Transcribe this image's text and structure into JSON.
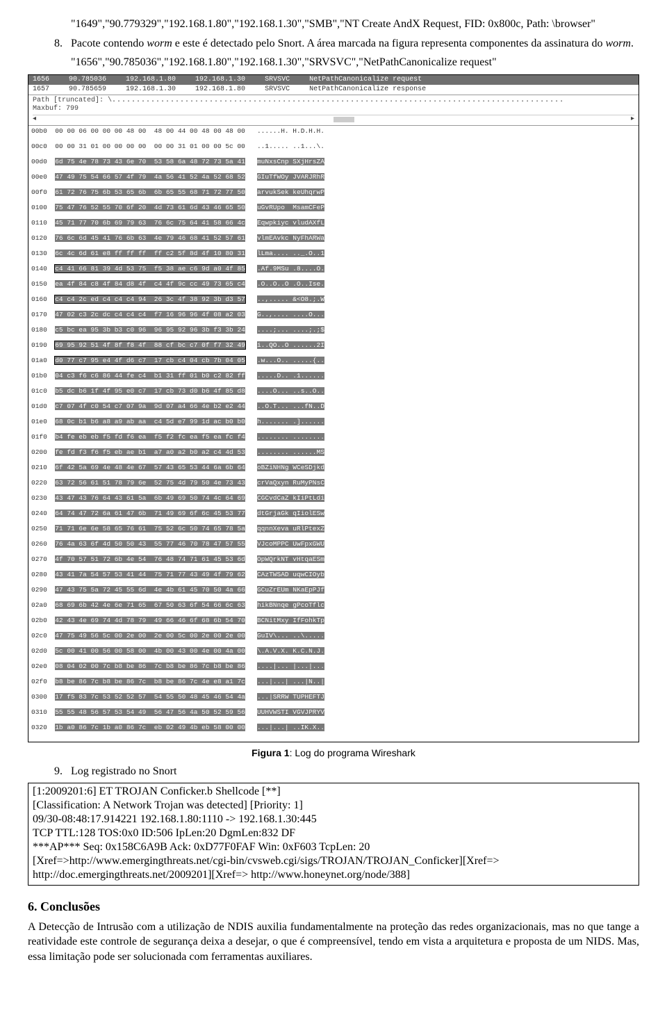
{
  "top": {
    "code_line": "\"1649\",\"90.779329\",\"192.168.1.80\",\"192.168.1.30\",\"SMB\",\"NT Create AndX Request, FID: 0x800c, Path: \\browser\"",
    "step8_num": "8.",
    "step8_text": "Pacote contendo worm e este é detectado pelo Snort. A área marcada na figura  representa componentes da assinatura do worm.",
    "code_line2": "\"1656\",\"90.785036\",\"192.168.1.80\",\"192.168.1.30\",\"SRVSVC\",\"NetPathCanonicalize request\""
  },
  "shot": {
    "list": {
      "row_sel": [
        "1656",
        "90.785036",
        "192.168.1.80",
        "192.168.1.30",
        "SRVSVC",
        "NetPathCanonicalize request"
      ],
      "row2": [
        "1657",
        "90.785659",
        "192.168.1.30",
        "192.168.1.80",
        "SRVSVC",
        "NetPathCanonicalize response"
      ]
    },
    "mid": {
      "path_label": "Path [truncated]: \\",
      "maxbuf": "Maxbuf: 799"
    }
  },
  "hex": [
    {
      "off": "00b0",
      "bytes": "00 00 06 00 00 00 48 00  48 00 44 00 48 00 48 00",
      "ascii": "......H. H.D.H.H."
    },
    {
      "off": "00c0",
      "bytes": "00 00 31 01 00 00 00 00  00 00 31 01 00 00 5c 00",
      "ascii": "..1..... ..1...\\."
    },
    {
      "off": "00d0",
      "bytes": "6d 75 4e 78 73 43 6e 70  53 58 6a 48 72 73 5a 41",
      "ascii": "muNxsCnp SXjHrsZA",
      "sel": true
    },
    {
      "off": "00e0",
      "bytes": "47 49 75 54 66 57 4f 79  4a 56 41 52 4a 52 68 52",
      "ascii": "GIuTfWOy JVARJRhR",
      "sel": true
    },
    {
      "off": "00f0",
      "bytes": "61 72 76 75 6b 53 65 6b  6b 65 55 68 71 72 77 50",
      "ascii": "arvukSek keUhqrwP",
      "sel": true
    },
    {
      "off": "0100",
      "bytes": "75 47 76 52 55 70 6f 20  4d 73 61 6d 43 46 65 50",
      "ascii": "uGvRUpo  MsamCFeP",
      "sel": true
    },
    {
      "off": "0110",
      "bytes": "45 71 77 70 6b 69 79 63  76 6c 75 64 41 58 66 4c",
      "ascii": "Eqwpkiyc vludAXfL",
      "sel": true
    },
    {
      "off": "0120",
      "bytes": "76 6c 6d 45 41 76 6b 63  4e 79 46 68 41 52 57 61",
      "ascii": "vlmEAvkc NyFhARWa",
      "sel": true
    },
    {
      "off": "0130",
      "bytes": "6c 4c 6d 61 e8 ff ff ff  ff c2 5f 8d 4f 10 80 31",
      "ascii": "lLma.... .._.O..1",
      "sel": true
    },
    {
      "off": "0140",
      "bytes": "c4 41 66 81 39 4d 53 75  f5 38 ae c6 9d a0 4f 85",
      "ascii": ".Af.9MSu .8....O.",
      "sel": true,
      "box": true
    },
    {
      "off": "0150",
      "bytes": "ea 4f 84 c8 4f 84 d8 4f  c4 4f 9c cc 49 73 65 c4",
      "ascii": ".O..O..O .O..Ise.",
      "sel": true
    },
    {
      "off": "0160",
      "bytes": "c4 c4 2c ed c4 c4 c4 94  26 3c 4f 38 92 3b d3 57",
      "ascii": "..,..... &<O8.;.W",
      "sel": true,
      "box": true
    },
    {
      "off": "0170",
      "bytes": "47 02 c3 2c dc c4 c4 c4  f7 16 96 96 4f 08 a2 03",
      "ascii": "G..,.... ....O...",
      "sel": true
    },
    {
      "off": "0180",
      "bytes": "c5 bc ea 95 3b b3 c0 96  96 95 92 96 3b f3 3b 24",
      "ascii": "....;... ....;.;$",
      "sel": true
    },
    {
      "off": "0190",
      "bytes": "69 95 92 51 4f 8f f8 4f  88 cf bc c7 0f f7 32 49",
      "ascii": "i..QO..O ......2I",
      "sel": true,
      "box": true
    },
    {
      "off": "01a0",
      "bytes": "d0 77 c7 95 e4 4f d6 c7  17 cb c4 04 cb 7b 04 05",
      "ascii": ".w...O.. .....{..",
      "sel": true,
      "box": true
    },
    {
      "off": "01b0",
      "bytes": "04 c3 f6 c6 86 44 fe c4  b1 31 ff 01 b0 c2 82 ff",
      "ascii": ".....D.. .1......",
      "sel": true
    },
    {
      "off": "01c0",
      "bytes": "b5 dc b6 1f 4f 95 e0 c7  17 cb 73 d0 b6 4f 85 d8",
      "ascii": "....O... ..s..O..",
      "sel": true
    },
    {
      "off": "01d0",
      "bytes": "c7 07 4f c0 54 c7 07 9a  9d 07 a4 66 4e b2 e2 44",
      "ascii": "..O.T... ...fN..D",
      "sel": true
    },
    {
      "off": "01e0",
      "bytes": "68 0c b1 b6 a8 a9 ab aa  c4 5d e7 99 1d ac b0 b0",
      "ascii": "h....... .]......",
      "sel": true
    },
    {
      "off": "01f0",
      "bytes": "b4 fe eb eb f5 fd f6 ea  f5 f2 fc ea f5 ea fc f4",
      "ascii": "........ ........",
      "sel": true
    },
    {
      "off": "0200",
      "bytes": "fe fd f3 f6 f5 eb ae b1  a7 a0 a2 b0 a2 c4 4d 53",
      "ascii": "........ ......MS",
      "sel": true
    },
    {
      "off": "0210",
      "bytes": "6f 42 5a 69 4e 48 4e 67  57 43 65 53 44 6a 6b 64",
      "ascii": "oBZiNHNg WCeSDjkd",
      "sel": true
    },
    {
      "off": "0220",
      "bytes": "63 72 56 61 51 78 79 6e  52 75 4d 79 50 4e 73 43",
      "ascii": "crVaQxyn RuMyPNsC",
      "sel": true
    },
    {
      "off": "0230",
      "bytes": "43 47 43 76 64 43 61 5a  6b 49 69 50 74 4c 64 69",
      "ascii": "CGCvdCaZ kIiPtLdi",
      "sel": true
    },
    {
      "off": "0240",
      "bytes": "64 74 47 72 6a 61 47 6b  71 49 69 6f 6c 45 53 77",
      "ascii": "dtGrjaGk qIiolESw",
      "sel": true
    },
    {
      "off": "0250",
      "bytes": "71 71 6e 6e 58 65 76 61  75 52 6c 50 74 65 78 5a",
      "ascii": "qqnnXeva uRlPtexZ",
      "sel": true
    },
    {
      "off": "0260",
      "bytes": "76 4a 63 6f 4d 50 50 43  55 77 46 70 78 47 57 55",
      "ascii": "VJcoMPPC UwFpxGWU",
      "sel": true
    },
    {
      "off": "0270",
      "bytes": "4f 70 57 51 72 6b 4e 54  76 48 74 71 61 45 53 6d",
      "ascii": "OpWQrkNT vHtqaESm",
      "sel": true
    },
    {
      "off": "0280",
      "bytes": "43 41 7a 54 57 53 41 44  75 71 77 43 49 4f 79 62",
      "ascii": "CAzTWSAD uqwCIOyb",
      "sel": true
    },
    {
      "off": "0290",
      "bytes": "47 43 75 5a 72 45 55 6d  4e 4b 61 45 70 50 4a 66",
      "ascii": "GCuZrEUm NKaEpPJf",
      "sel": true
    },
    {
      "off": "02a0",
      "bytes": "68 69 6b 42 4e 6e 71 65  67 50 63 6f 54 66 6c 63",
      "ascii": "hikBNnqe gPcoTflc",
      "sel": true
    },
    {
      "off": "02b0",
      "bytes": "42 43 4e 69 74 4d 78 79  49 66 46 6f 68 6b 54 70",
      "ascii": "BCNitMxy IfFohkTp",
      "sel": true
    },
    {
      "off": "02c0",
      "bytes": "47 75 49 56 5c 00 2e 00  2e 00 5c 00 2e 00 2e 00",
      "ascii": "GuIV\\... ..\\.....",
      "sel": true
    },
    {
      "off": "02d0",
      "bytes": "5c 00 41 00 56 00 58 00  4b 00 43 00 4e 00 4a 00",
      "ascii": "\\.A.V.X. K.C.N.J.",
      "sel": true
    },
    {
      "off": "02e0",
      "bytes": "08 04 02 00 7c b8 be 86  7c b8 be 86 7c b8 be 86",
      "ascii": "....|... |...|...",
      "sel": true
    },
    {
      "off": "02f0",
      "bytes": "b8 be 86 7c b8 be 86 7c  b8 be 86 7c 4e e8 a1 7c",
      "ascii": "...|...| ...|N..|",
      "sel": true
    },
    {
      "off": "0300",
      "bytes": "17 f5 83 7c 53 52 52 57  54 55 50 48 45 46 54 4a",
      "ascii": "...|SRRW TUPHEFTJ",
      "sel": true
    },
    {
      "off": "0310",
      "bytes": "55 55 48 56 57 53 54 49  56 47 56 4a 50 52 59 56",
      "ascii": "UUHVWSTI VGVJPRYV",
      "sel": true
    },
    {
      "off": "0320",
      "bytes": "1b a0 86 7c 1b a0 86 7c  eb 02 49 4b eb 58 00 00",
      "ascii": "...|...| ..IK.X..",
      "sel": true
    }
  ],
  "fig": {
    "label": "Figura 1",
    "caption_rest": ": Log do programa Wireshark"
  },
  "step9": {
    "num": "9.",
    "text": "Log registrado no Snort"
  },
  "snort": {
    "l1": "[1:2009201:6] ET TROJAN Conficker.b Shellcode [**]",
    "l2": "[Classification: A Network Trojan was detected] [Priority: 1]",
    "l3": "09/30-08:48:17.914221 192.168.1.80:1110 -> 192.168.1.30:445",
    "l4": "TCP TTL:128 TOS:0x0 ID:506 IpLen:20 DgmLen:832 DF",
    "l5": "***AP*** Seq: 0x158C6A9B  Ack: 0xD77F0FAF  Win: 0xF603  TcpLen: 20",
    "l6": "[Xref=>http://www.emergingthreats.net/cgi-bin/cvsweb.cgi/sigs/TROJAN/TROJAN_Conficker][Xref=> http://doc.emergingthreats.net/2009201][Xref=> http://www.honeynet.org/node/388]"
  },
  "sec6": {
    "heading": "6. Conclusões",
    "para": "A Detecção de Intrusão com a utilização de NDIS auxilia fundamentalmente na proteção das redes organizacionais, mas no que tange a reatividade este controle de segurança deixa a desejar, o que é compreensível, tendo em vista a arquitetura e proposta de um NIDS. Mas, essa limitação pode ser solucionada com ferramentas auxiliares."
  }
}
